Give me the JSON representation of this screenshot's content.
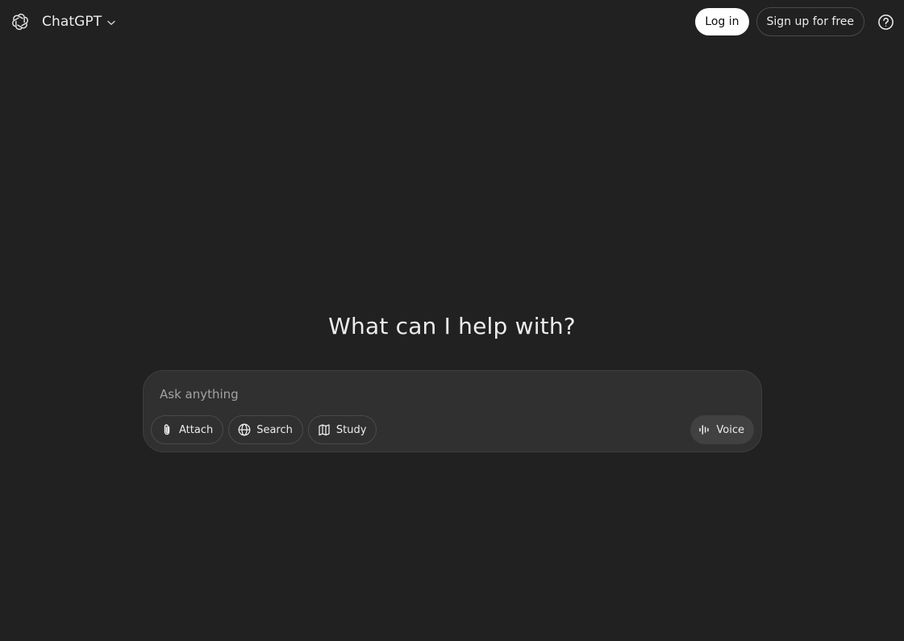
{
  "header": {
    "app_name": "ChatGPT",
    "login_label": "Log in",
    "signup_label": "Sign up for free",
    "help_icon": "question-circle-icon",
    "logo_icon": "openai-logo-icon"
  },
  "main": {
    "headline": "What can I help with?"
  },
  "composer": {
    "placeholder": "Ask anything",
    "value": "",
    "tools": [
      {
        "label": "Attach",
        "icon": "paperclip-icon"
      },
      {
        "label": "Search",
        "icon": "globe-icon"
      },
      {
        "label": "Study",
        "icon": "book-icon"
      }
    ],
    "voice_label": "Voice",
    "voice_icon": "waveform-icon"
  },
  "colors": {
    "background": "#212121",
    "composer": "#303030",
    "login_button": "#ffffff",
    "voice_button": "#414141"
  }
}
